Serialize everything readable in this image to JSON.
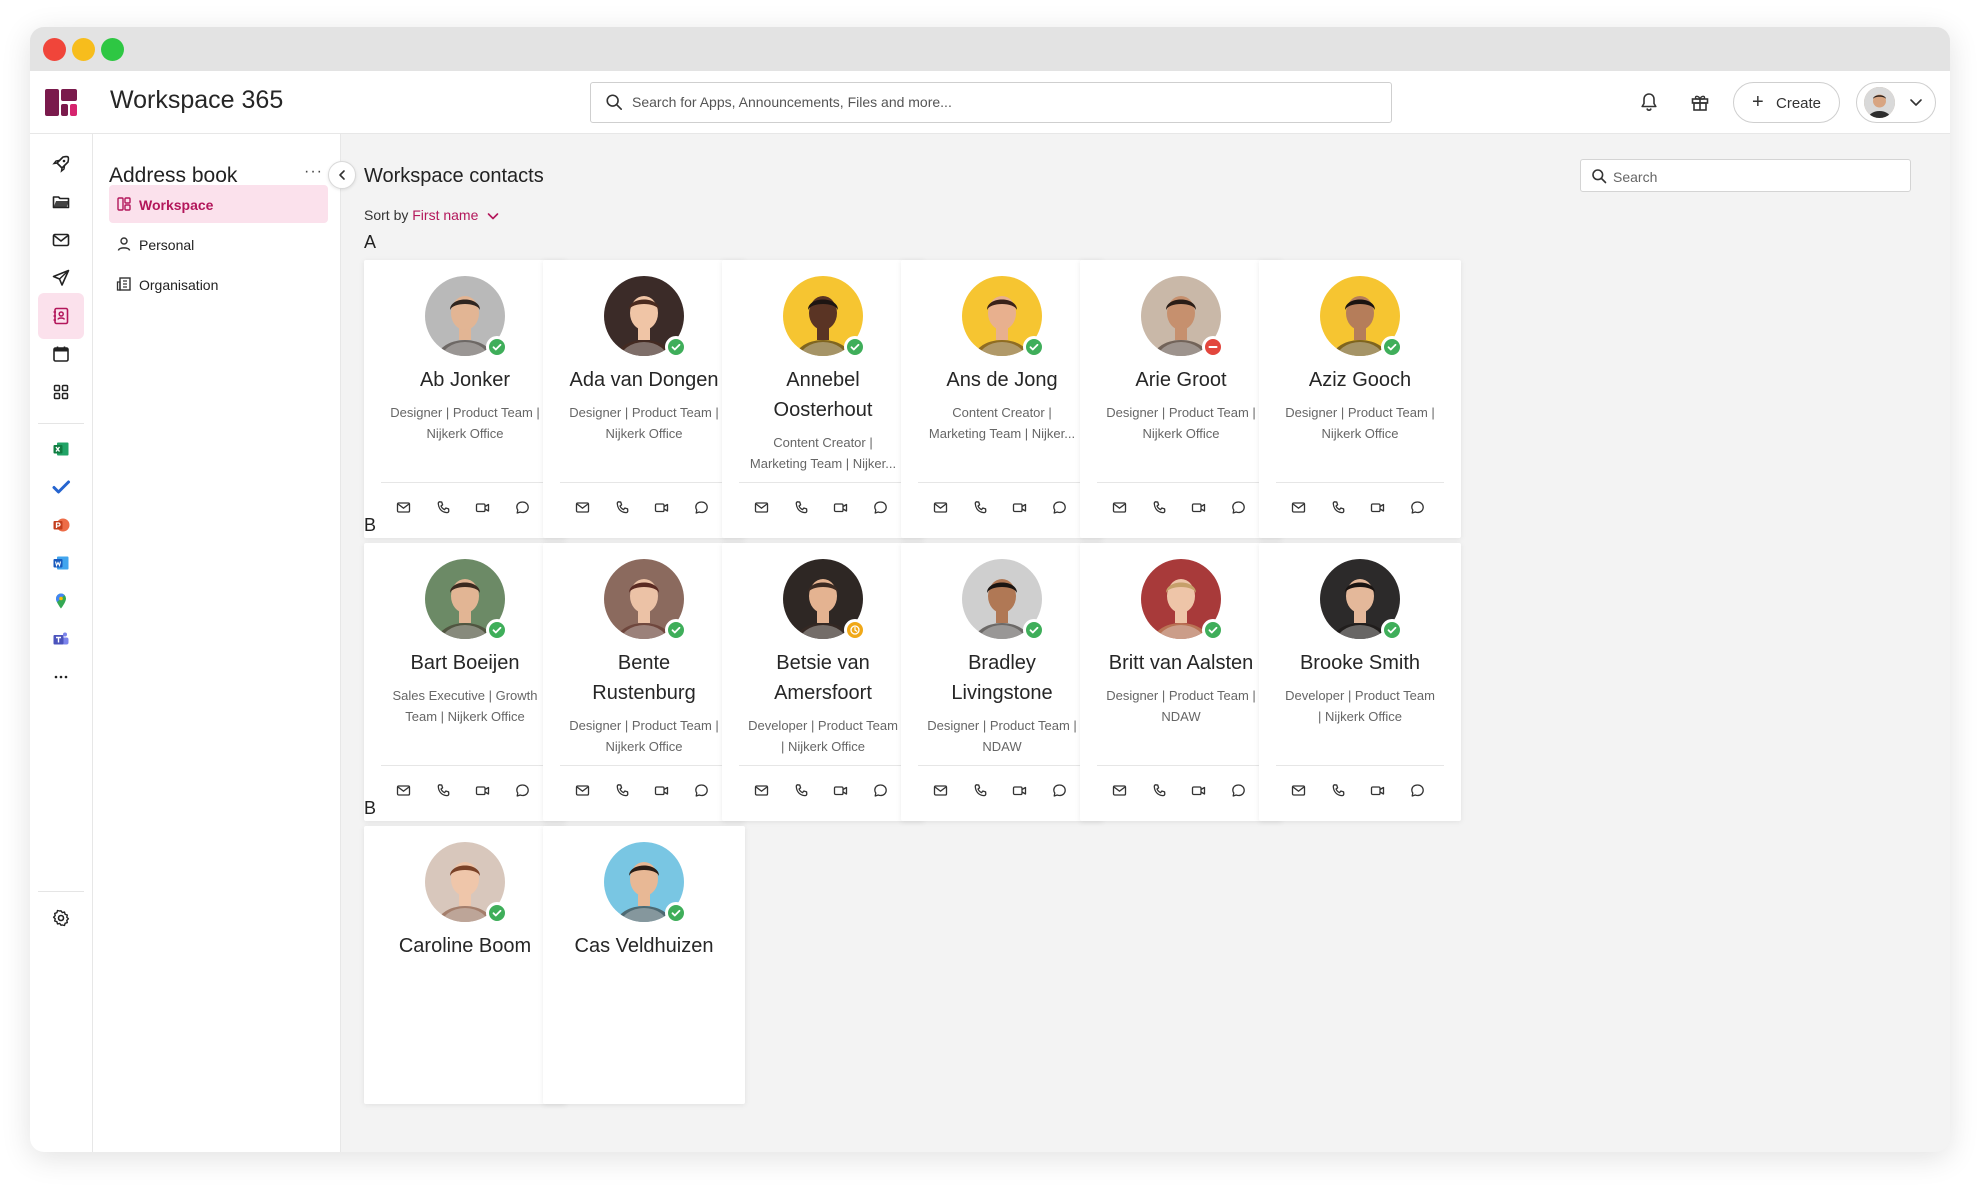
{
  "app": {
    "title": "Workspace 365",
    "search_placeholder": "Search for Apps, Announcements, Files and more...",
    "create_label": "Create"
  },
  "colors": {
    "accent": "#b3175b",
    "accent_bg": "#fbe1ec",
    "status_available": "#3fae5a",
    "status_busy": "#e2463d",
    "status_away": "#f0a818"
  },
  "rail": {
    "items": [
      "rocket-icon",
      "folder-icon",
      "mail-icon",
      "send-icon",
      "contacts-icon",
      "calendar-icon",
      "apps-icon",
      "excel-icon",
      "todo-icon",
      "powerpoint-icon",
      "word-icon",
      "maps-icon",
      "teams-icon",
      "more-icon"
    ],
    "active": "contacts-icon",
    "settings": "gear-icon"
  },
  "sidepanel": {
    "title": "Address book",
    "more": "···",
    "items": [
      {
        "label": "Workspace",
        "icon": "workspace-icon",
        "active": true
      },
      {
        "label": "Personal",
        "icon": "person-icon",
        "active": false
      },
      {
        "label": "Organisation",
        "icon": "building-icon",
        "active": false
      }
    ]
  },
  "main": {
    "title": "Workspace contacts",
    "sort_label": "Sort by",
    "sort_value": "First name",
    "search_placeholder": "Search"
  },
  "sections": [
    {
      "letter": "A",
      "contacts": [
        {
          "name": [
            "Ab Jonker"
          ],
          "role": [
            "Designer | Product Team |",
            "Nijkerk Office"
          ],
          "status": "available",
          "bg": "#b9b9b9",
          "skin": "#e2b594",
          "hair": "#2f2621"
        },
        {
          "name": [
            "Ada van Dongen"
          ],
          "role": [
            "Designer | Product Team |",
            "Nijkerk Office"
          ],
          "status": "available",
          "bg": "#3b2b28",
          "skin": "#f0c5a6",
          "hair": "#4a2a1e"
        },
        {
          "name": [
            "Annebel",
            "Oosterhout"
          ],
          "role": [
            "Content Creator |",
            "Marketing Team | Nijker..."
          ],
          "status": "available",
          "bg": "#f6c531",
          "skin": "#5a3424",
          "hair": "#1d1512"
        },
        {
          "name": [
            "Ans de Jong"
          ],
          "role": [
            "Content Creator |",
            "Marketing Team | Nijker..."
          ],
          "status": "available",
          "bg": "#f6c531",
          "skin": "#e8b08e",
          "hair": "#3a2218"
        },
        {
          "name": [
            "Arie Groot"
          ],
          "role": [
            "Designer | Product Team |",
            "Nijkerk Office"
          ],
          "status": "busy",
          "bg": "#c9b8a8",
          "skin": "#c6906e",
          "hair": "#2a1d17"
        },
        {
          "name": [
            "Aziz Gooch"
          ],
          "role": [
            "Designer | Product Team |",
            "Nijkerk Office"
          ],
          "status": "available",
          "bg": "#f6c531",
          "skin": "#b57d5a",
          "hair": "#1b1410"
        }
      ]
    },
    {
      "letter": "B",
      "contacts": [
        {
          "name": [
            "Bart Boeijen"
          ],
          "role": [
            "Sales Executive | Growth",
            "Team | Nijkerk Office"
          ],
          "status": "available",
          "bg": "#6c8a66",
          "skin": "#e2b594",
          "hair": "#3b2a20"
        },
        {
          "name": [
            "Bente",
            "Rustenburg"
          ],
          "role": [
            "Designer | Product Team |",
            "Nijkerk Office"
          ],
          "status": "available",
          "bg": "#8b6a5e",
          "skin": "#ecc2a6",
          "hair": "#5a2a22"
        },
        {
          "name": [
            "Betsie van",
            "Amersfoort"
          ],
          "role": [
            "Developer | Product Team",
            "| Nijkerk Office"
          ],
          "status": "away",
          "bg": "#2e2724",
          "skin": "#e4b391",
          "hair": "#3b2a22"
        },
        {
          "name": [
            "Bradley",
            "Livingstone"
          ],
          "role": [
            "Designer | Product Team |",
            "NDAW"
          ],
          "status": "available",
          "bg": "#cfcfcf",
          "skin": "#b07855",
          "hair": "#1b1512"
        },
        {
          "name": [
            "Britt van Aalsten"
          ],
          "role": [
            "Designer | Product Team |",
            "NDAW"
          ],
          "status": "available",
          "bg": "#a83a3a",
          "skin": "#eec5a8",
          "hair": "#c6a06a"
        },
        {
          "name": [
            "Brooke Smith"
          ],
          "role": [
            "Developer | Product Team",
            "| Nijkerk Office"
          ],
          "status": "available",
          "bg": "#2c2a2a",
          "skin": "#e4b89a",
          "hair": "#1a1412"
        }
      ]
    },
    {
      "letter": "B",
      "contacts": [
        {
          "name": [
            "Caroline Boom"
          ],
          "role": [],
          "status": "available",
          "bg": "#d8c7bc",
          "skin": "#efc6aa",
          "hair": "#7a4228"
        },
        {
          "name": [
            "Cas Veldhuizen"
          ],
          "role": [],
          "status": "available",
          "bg": "#79c6e3",
          "skin": "#e8b895",
          "hair": "#2a1d16"
        }
      ]
    }
  ],
  "card_actions": [
    "mail-icon",
    "phone-icon",
    "video-icon",
    "chat-icon"
  ]
}
